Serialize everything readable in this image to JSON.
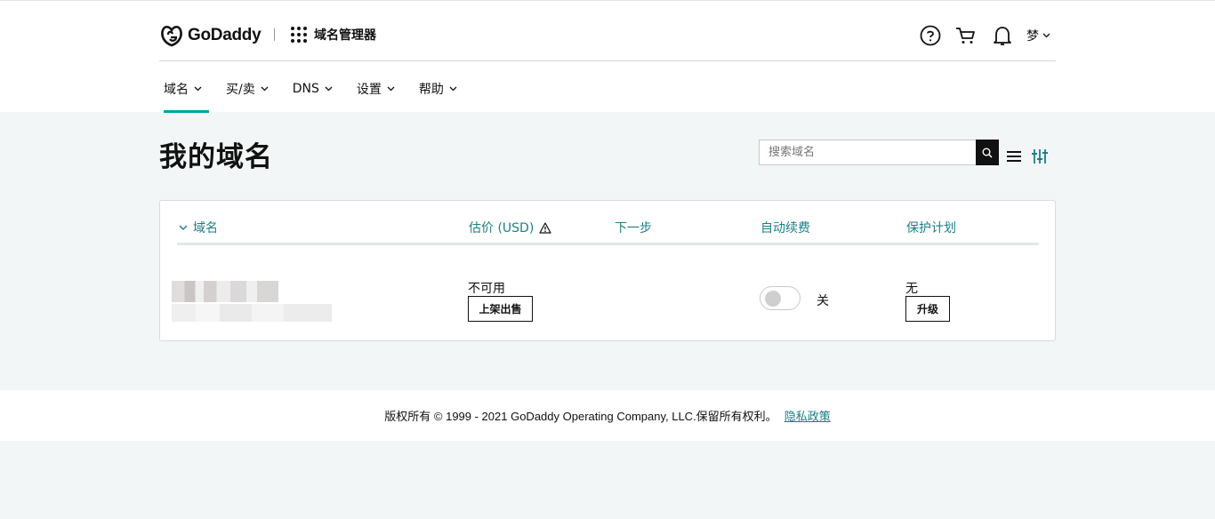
{
  "brand": {
    "name": "GoDaddy",
    "product": "域名管理器"
  },
  "header": {
    "icons": [
      "help-icon",
      "cart-icon",
      "bell-icon"
    ],
    "user": "梦"
  },
  "nav": [
    {
      "label": "域名",
      "active": true
    },
    {
      "label": "买/卖"
    },
    {
      "label": "DNS"
    },
    {
      "label": "设置"
    },
    {
      "label": "帮助"
    }
  ],
  "page": {
    "title": "我的域名"
  },
  "search": {
    "placeholder": "搜索域名",
    "value": ""
  },
  "table": {
    "headers": {
      "domain": "域名",
      "value": "估价 (USD)",
      "next": "下一步",
      "autorenew": "自动续费",
      "protection": "保护计划"
    },
    "rows": [
      {
        "value_text": "不可用",
        "sell_button": "上架出售",
        "autorenew_on": false,
        "autorenew_label": "关",
        "protection_text": "无",
        "upgrade_button": "升级"
      }
    ]
  },
  "footer": {
    "copyright": "版权所有 © 1999 - 2021 GoDaddy Operating Company, LLC.保留所有权利。",
    "privacy_link": "隐私政策"
  },
  "colors": {
    "accent": "#00a4a6",
    "link": "#1a7f87"
  }
}
